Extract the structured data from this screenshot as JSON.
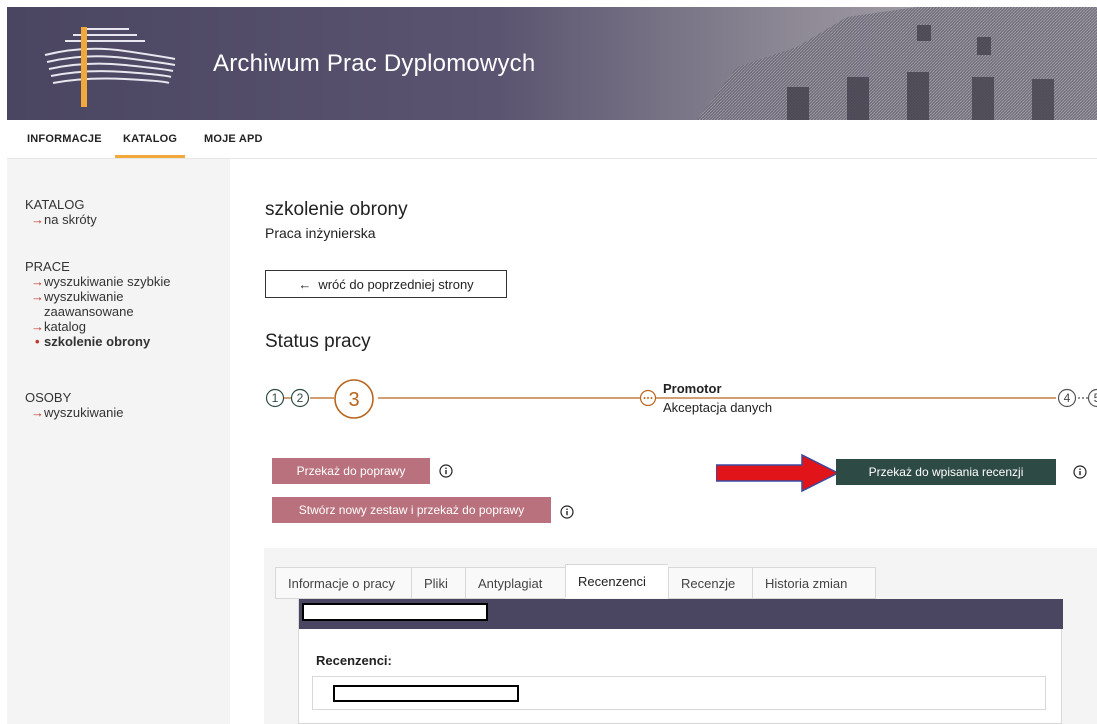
{
  "header": {
    "title": "Archiwum Prac Dyplomowych",
    "logo_icon": "library-logo-icon"
  },
  "topnav": {
    "items": [
      {
        "label": "INFORMACJE",
        "active": false
      },
      {
        "label": "KATALOG",
        "active": true
      },
      {
        "label": "MOJE APD",
        "active": false
      }
    ],
    "accent": "#f0a93a"
  },
  "sidebar": {
    "sections": [
      {
        "heading": "KATALOG",
        "links": [
          "na skróty"
        ]
      },
      {
        "heading": "PRACE",
        "links": [
          "wyszukiwanie szybkie",
          "wyszukiwanie zaawansowane",
          "katalog"
        ],
        "active_link": "szkolenie obrony"
      },
      {
        "heading": "OSOBY",
        "links": [
          "wyszukiwanie"
        ]
      }
    ]
  },
  "main": {
    "work_title": "szkolenie obrony",
    "work_type": "Praca inżynierska",
    "back_button": "wróć do poprzedniej strony",
    "status_title": "Status pracy"
  },
  "stepper": {
    "steps": [
      "1",
      "2",
      "3",
      "4",
      "5"
    ],
    "current_step": "3",
    "current_role": "Promotor",
    "current_action": "Akceptacja danych",
    "accent": "#b8651e"
  },
  "actions": {
    "return_for_correction": "Przekaż do poprawy",
    "new_set_and_return": "Stwórz nowy zestaw i przekaż do poprawy",
    "send_for_review": "Przekaż do wpisania recenzji",
    "rose_color": "#b9727d",
    "dark_color": "#2e4a45"
  },
  "tabs": {
    "items": [
      "Informacje o pracy",
      "Pliki",
      "Antyplagiat",
      "Recenzenci",
      "Recenzje",
      "Historia zmian"
    ],
    "active": "Recenzenci"
  },
  "card": {
    "label": "Recenzenci:",
    "header_color": "#4a4560"
  }
}
